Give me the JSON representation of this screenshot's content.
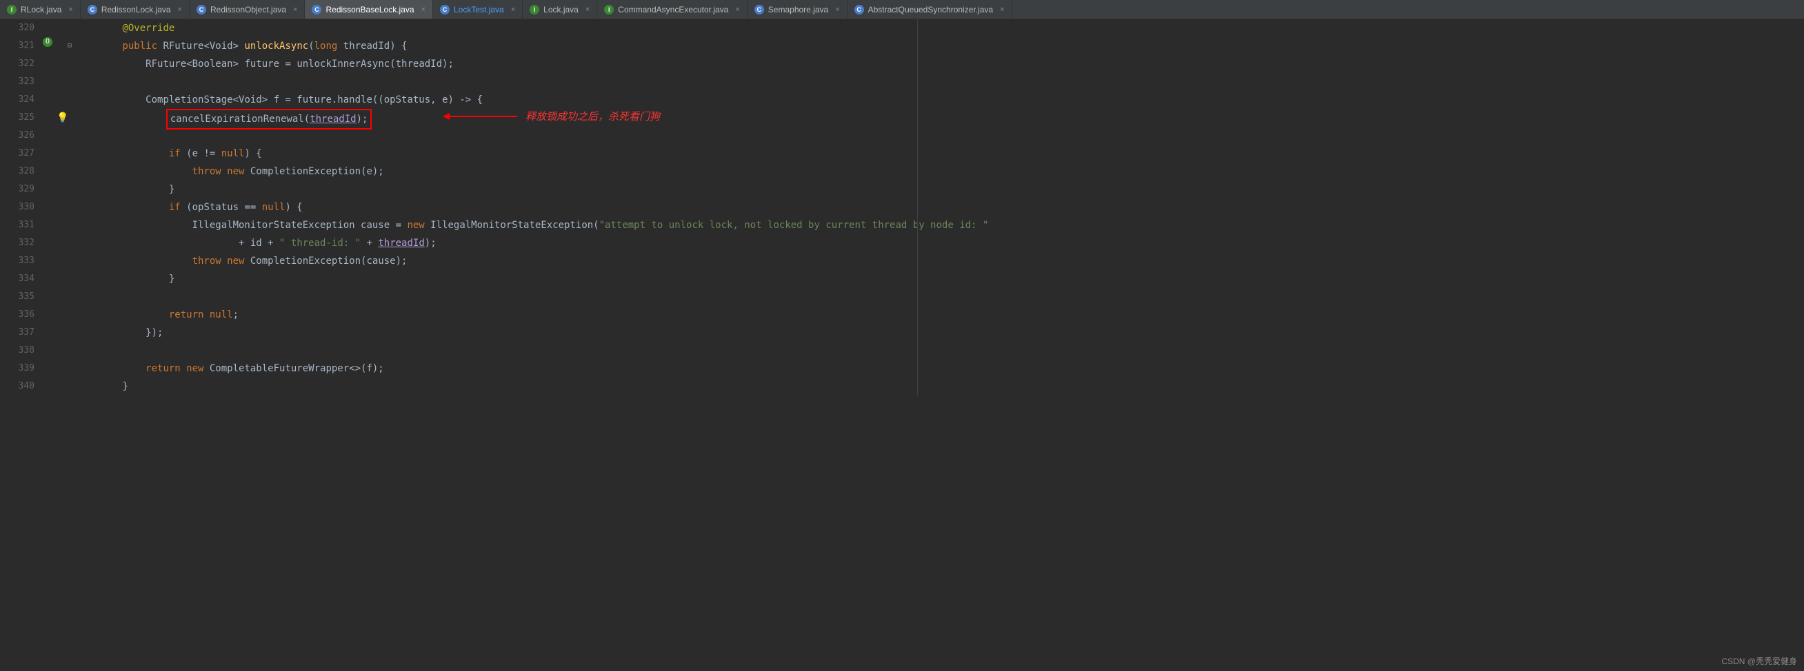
{
  "tabs": [
    {
      "icon": "I",
      "iconClass": "icon-interface",
      "label": "RLock.java",
      "active": false
    },
    {
      "icon": "C",
      "iconClass": "icon-class",
      "label": "RedissonLock.java",
      "active": false
    },
    {
      "icon": "C",
      "iconClass": "icon-class",
      "label": "RedissonObject.java",
      "active": false
    },
    {
      "icon": "C",
      "iconClass": "icon-class",
      "label": "RedissonBaseLock.java",
      "active": true
    },
    {
      "icon": "C",
      "iconClass": "icon-class",
      "label": "LockTest.java",
      "active": false,
      "highlight": true
    },
    {
      "icon": "I",
      "iconClass": "icon-interface",
      "label": "Lock.java",
      "active": false
    },
    {
      "icon": "I",
      "iconClass": "icon-interface",
      "label": "CommandAsyncExecutor.java",
      "active": false
    },
    {
      "icon": "C",
      "iconClass": "icon-class",
      "label": "Semaphore.java",
      "active": false
    },
    {
      "icon": "C",
      "iconClass": "icon-class",
      "label": "AbstractQueuedSynchronizer.java",
      "active": false
    }
  ],
  "lineStart": 320,
  "lineEnd": 340,
  "code": {
    "l320": {
      "indent": "        ",
      "tokens": [
        {
          "t": "@Override",
          "c": "anno"
        }
      ]
    },
    "l321": {
      "indent": "        ",
      "tokens": [
        {
          "t": "public ",
          "c": "kw"
        },
        {
          "t": "RFuture<Void> ",
          "c": "type"
        },
        {
          "t": "unlockAsync",
          "c": "method"
        },
        {
          "t": "(",
          "c": "plain"
        },
        {
          "t": "long ",
          "c": "kw"
        },
        {
          "t": "threadId) {",
          "c": "plain"
        }
      ]
    },
    "l322": {
      "indent": "            ",
      "tokens": [
        {
          "t": "RFuture<Boolean> future = ",
          "c": "plain"
        },
        {
          "t": "unlockInnerAsync(threadId);",
          "c": "plain"
        }
      ]
    },
    "l323": {
      "indent": "",
      "tokens": []
    },
    "l324": {
      "indent": "            ",
      "tokens": [
        {
          "t": "CompletionStage<Void> f = future.handle((opStatus, e) -> {",
          "c": "plain"
        }
      ]
    },
    "l325": {
      "indent": "                ",
      "boxed": true,
      "tokens": [
        {
          "t": "cancelExpirationRenewal(",
          "c": "plain"
        },
        {
          "t": "threadId",
          "c": "param"
        },
        {
          "t": ");",
          "c": "plain"
        }
      ]
    },
    "l326": {
      "indent": "",
      "tokens": []
    },
    "l327": {
      "indent": "                ",
      "tokens": [
        {
          "t": "if ",
          "c": "kw"
        },
        {
          "t": "(e != ",
          "c": "plain"
        },
        {
          "t": "null",
          "c": "kw"
        },
        {
          "t": ") {",
          "c": "plain"
        }
      ]
    },
    "l328": {
      "indent": "                    ",
      "tokens": [
        {
          "t": "throw new ",
          "c": "kw"
        },
        {
          "t": "CompletionException(e);",
          "c": "plain"
        }
      ]
    },
    "l329": {
      "indent": "                ",
      "tokens": [
        {
          "t": "}",
          "c": "plain"
        }
      ]
    },
    "l330": {
      "indent": "                ",
      "tokens": [
        {
          "t": "if ",
          "c": "kw"
        },
        {
          "t": "(opStatus == ",
          "c": "plain"
        },
        {
          "t": "null",
          "c": "kw"
        },
        {
          "t": ") {",
          "c": "plain"
        }
      ]
    },
    "l331": {
      "indent": "                    ",
      "tokens": [
        {
          "t": "IllegalMonitorStateException cause = ",
          "c": "plain"
        },
        {
          "t": "new ",
          "c": "kw"
        },
        {
          "t": "IllegalMonitorStateException(",
          "c": "plain"
        },
        {
          "t": "\"attempt to unlock lock, not locked by current thread by node id: \"",
          "c": "str"
        }
      ]
    },
    "l332": {
      "indent": "                            ",
      "tokens": [
        {
          "t": "+ id + ",
          "c": "plain"
        },
        {
          "t": "\" thread-id: \"",
          "c": "str"
        },
        {
          "t": " + ",
          "c": "plain"
        },
        {
          "t": "threadId",
          "c": "param"
        },
        {
          "t": ");",
          "c": "plain"
        }
      ]
    },
    "l333": {
      "indent": "                    ",
      "tokens": [
        {
          "t": "throw new ",
          "c": "kw"
        },
        {
          "t": "CompletionException(cause);",
          "c": "plain"
        }
      ]
    },
    "l334": {
      "indent": "                ",
      "tokens": [
        {
          "t": "}",
          "c": "plain"
        }
      ]
    },
    "l335": {
      "indent": "",
      "tokens": []
    },
    "l336": {
      "indent": "                ",
      "tokens": [
        {
          "t": "return ",
          "c": "kw"
        },
        {
          "t": "null",
          "c": "kw"
        },
        {
          "t": ";",
          "c": "plain"
        }
      ]
    },
    "l337": {
      "indent": "            ",
      "tokens": [
        {
          "t": "});",
          "c": "plain"
        }
      ]
    },
    "l338": {
      "indent": "",
      "tokens": []
    },
    "l339": {
      "indent": "            ",
      "tokens": [
        {
          "t": "return new ",
          "c": "kw"
        },
        {
          "t": "CompletableFutureWrapper<>(f);",
          "c": "plain"
        }
      ]
    },
    "l340": {
      "indent": "        ",
      "tokens": [
        {
          "t": "}",
          "c": "plain"
        }
      ]
    }
  },
  "annotation": "释放锁成功之后，杀死看门狗",
  "watermark": "CSDN @秃秃爱健身"
}
